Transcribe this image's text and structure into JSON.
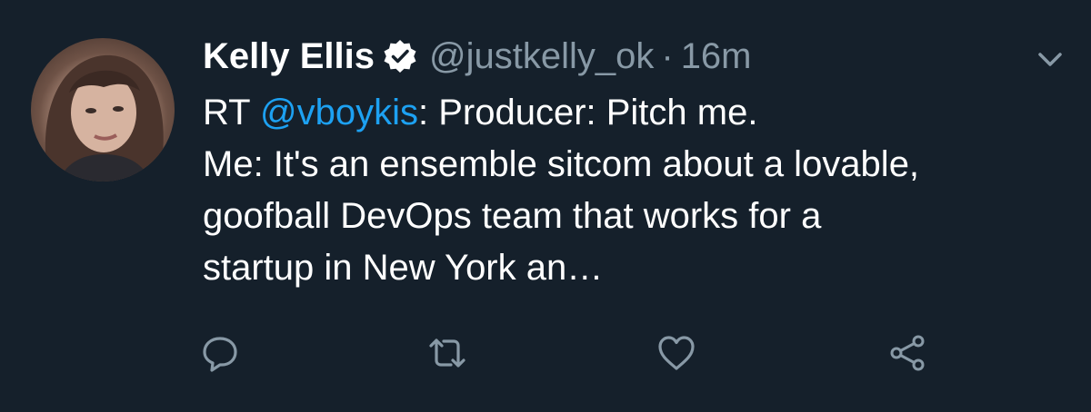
{
  "tweet": {
    "author_name": "Kelly Ellis",
    "handle": "@justkelly_ok",
    "separator": "·",
    "time": "16m",
    "text": {
      "prefix": "RT ",
      "mention": "@vboykis",
      "line1_rest": ": Producer: Pitch me.",
      "line2": "Me: It's an ensemble sitcom about a lovable,",
      "line3": "goofball DevOps team that works for a",
      "line4": "startup in New York an…"
    }
  },
  "icons": {
    "verified": "verified-badge-icon",
    "menu": "chevron-down-icon",
    "reply": "reply-icon",
    "retweet": "retweet-icon",
    "like": "heart-icon",
    "share": "share-icon"
  },
  "colors": {
    "background": "#15202b",
    "text": "#ffffff",
    "secondary": "#8899a6",
    "link": "#1da1f2"
  }
}
